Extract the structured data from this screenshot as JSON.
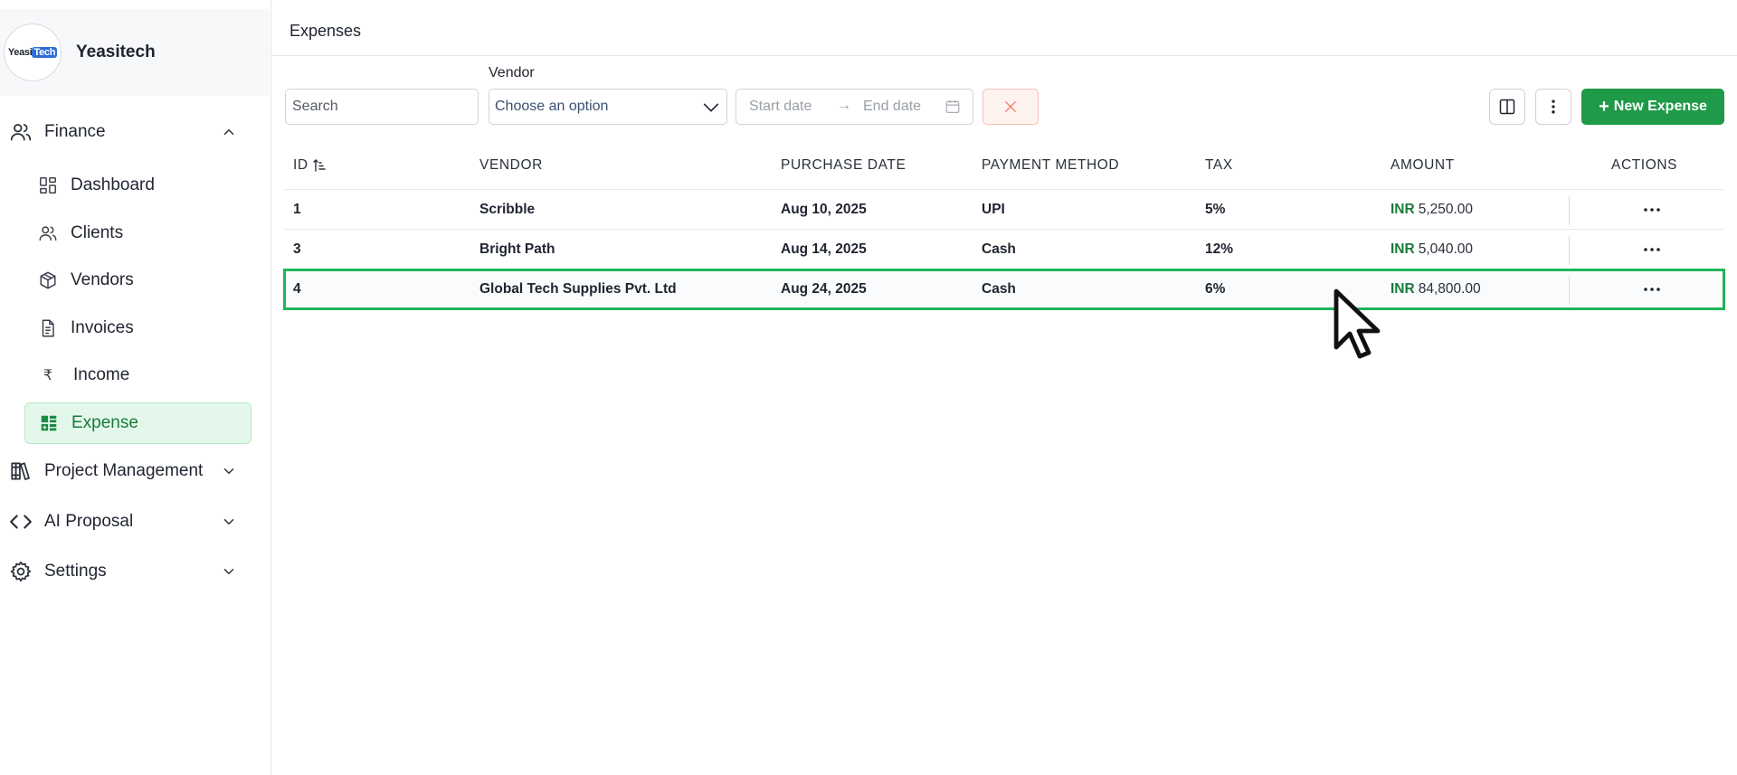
{
  "brand": {
    "logo_part1": "Yeasi",
    "logo_part2": "Tech",
    "name": "Yeasitech"
  },
  "sidebar": {
    "finance": {
      "label": "Finance",
      "icon": "users-icon",
      "expanded": true
    },
    "items": [
      {
        "label": "Dashboard",
        "icon": "dashboard-icon"
      },
      {
        "label": "Clients",
        "icon": "users-icon"
      },
      {
        "label": "Vendors",
        "icon": "box-icon"
      },
      {
        "label": "Invoices",
        "icon": "document-icon"
      },
      {
        "label": "Income",
        "icon": "rupee-icon",
        "glyph": "₹"
      },
      {
        "label": "Expense",
        "icon": "table-icon",
        "active": true
      }
    ],
    "project_management": {
      "label": "Project Management",
      "icon": "books-icon"
    },
    "ai_proposal": {
      "label": "AI Proposal",
      "icon": "code-icon"
    },
    "settings": {
      "label": "Settings",
      "icon": "gear-icon"
    }
  },
  "header": {
    "title": "Expenses"
  },
  "filters": {
    "search_placeholder": "Search",
    "vendor_label": "Vendor",
    "vendor_placeholder": "Choose an option",
    "start_date_placeholder": "Start date",
    "date_arrow": "→",
    "end_date_placeholder": "End date"
  },
  "toolbar": {
    "new_expense_plus": "+",
    "new_expense_label": "New Expense"
  },
  "table": {
    "columns": [
      "ID",
      "VENDOR",
      "PURCHASE DATE",
      "PAYMENT METHOD",
      "TAX",
      "AMOUNT",
      "ACTIONS"
    ],
    "rows": [
      {
        "id": "1",
        "vendor": "Scribble",
        "date": "Aug 10, 2025",
        "method": "UPI",
        "tax": "5%",
        "currency": "INR",
        "amount": "5,250.00"
      },
      {
        "id": "3",
        "vendor": "Bright Path",
        "date": "Aug 14, 2025",
        "method": "Cash",
        "tax": "12%",
        "currency": "INR",
        "amount": "5,040.00"
      },
      {
        "id": "4",
        "vendor": "Global Tech Supplies Pvt. Ltd",
        "date": "Aug 24, 2025",
        "method": "Cash",
        "tax": "6%",
        "currency": "INR",
        "amount": "84,800.00",
        "highlighted": true
      }
    ]
  },
  "colors": {
    "accent": "#1e9a48",
    "highlight": "#1fb55a",
    "active_bg": "#e3f8ea"
  }
}
